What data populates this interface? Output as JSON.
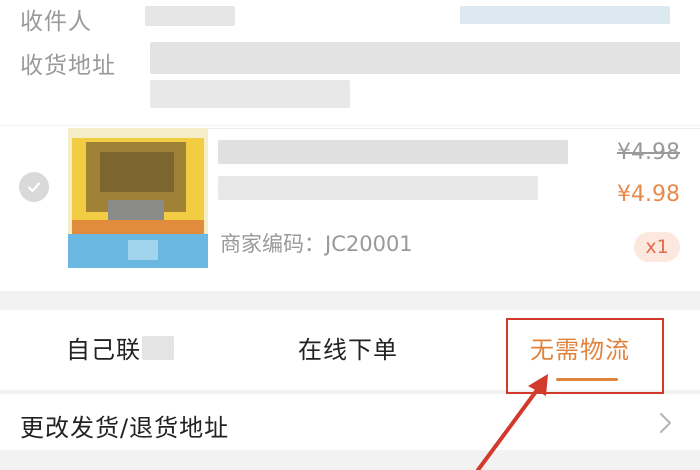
{
  "address_card": {
    "recipient_label": "收件人",
    "address_label": "收货地址"
  },
  "item": {
    "original_price": "¥4.98",
    "price": "¥4.98",
    "sku_label": "商家编码：JC20001",
    "quantity": "x1"
  },
  "shipping_options": [
    {
      "label": "自己联",
      "active": false
    },
    {
      "label": "在线下单",
      "active": false
    },
    {
      "label": "无需物流",
      "active": true
    }
  ],
  "change_address": {
    "label": "更改发货/退货地址"
  },
  "colors": {
    "accent": "#e0833d",
    "annotation_red": "#d23a2c"
  }
}
